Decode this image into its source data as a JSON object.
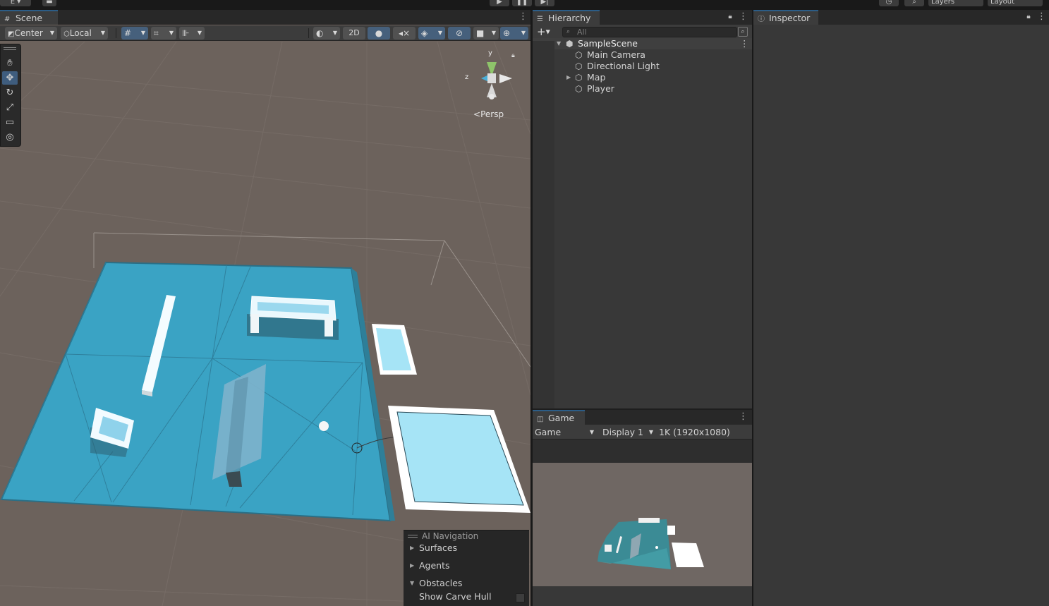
{
  "top": {
    "layers_label": "Layers",
    "layout_label": "Layout",
    "account_label": "E"
  },
  "scene": {
    "tab_label": "Scene",
    "toolbar": {
      "pivot_label": "Center",
      "space_label": "Local",
      "mode_2d_label": "2D"
    },
    "persp_label": "Persp",
    "gizmo": {
      "y_label": "y",
      "z_label": "z"
    },
    "overlay": {
      "title": "AI Navigation",
      "items": [
        {
          "label": "Surfaces",
          "expanded": false
        },
        {
          "label": "Agents",
          "expanded": false
        },
        {
          "label": "Obstacles",
          "expanded": true
        }
      ],
      "option_label": "Show Carve Hull"
    }
  },
  "hierarchy": {
    "tab_label": "Hierarchy",
    "search_placeholder": "All",
    "scene_name": "SampleScene",
    "items": [
      {
        "label": "Main Camera",
        "has_children": false
      },
      {
        "label": "Directional Light",
        "has_children": false
      },
      {
        "label": "Map",
        "has_children": true
      },
      {
        "label": "Player",
        "has_children": false
      }
    ]
  },
  "game": {
    "tab_label": "Game",
    "view_select": "Game",
    "display_select": "Display 1",
    "resolution_select": "1K (1920x1080)"
  },
  "inspector": {
    "tab_label": "Inspector"
  },
  "colors": {
    "accent": "#2c5d87",
    "navmesh": "#3aa3c4",
    "ground": "#6c625c",
    "obstacle_fill": "#a6e4f6"
  }
}
